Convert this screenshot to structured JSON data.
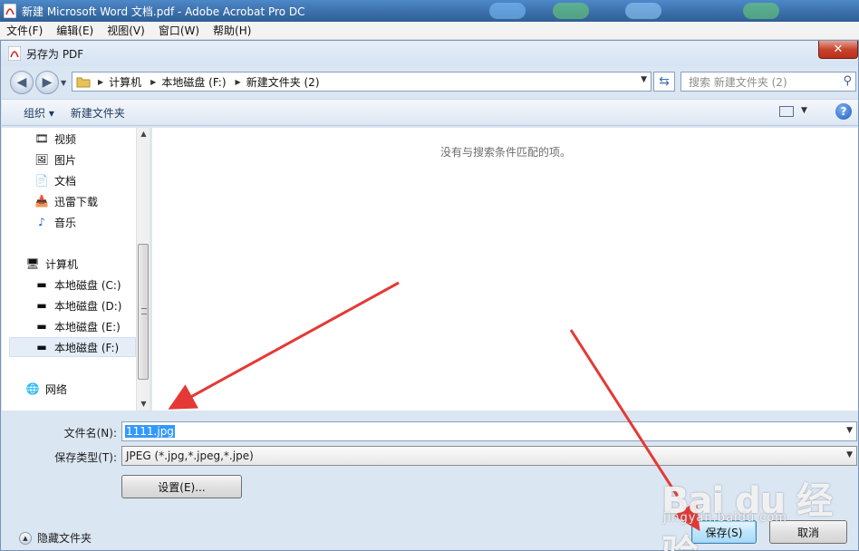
{
  "app": {
    "title": "新建 Microsoft Word 文档.pdf - Adobe Acrobat Pro DC",
    "menu": [
      "文件(F)",
      "编辑(E)",
      "视图(V)",
      "窗口(W)",
      "帮助(H)"
    ]
  },
  "dialog": {
    "title": "另存为 PDF",
    "close_label": "✕",
    "breadcrumb": [
      "计算机",
      "本地磁盘 (F:)",
      "新建文件夹 (2)"
    ],
    "search_placeholder": "搜索 新建文件夹 (2)",
    "toolbar": {
      "organize": "组织 ▾",
      "new_folder": "新建文件夹",
      "help": "?"
    },
    "nav_items": [
      {
        "label": "视频",
        "icon": "video-icon"
      },
      {
        "label": "图片",
        "icon": "picture-icon"
      },
      {
        "label": "文档",
        "icon": "document-icon"
      },
      {
        "label": "迅雷下载",
        "icon": "download-icon"
      },
      {
        "label": "音乐",
        "icon": "music-icon"
      },
      {
        "label": "计算机",
        "icon": "computer-icon"
      },
      {
        "label": "本地磁盘 (C:)",
        "icon": "drive-icon"
      },
      {
        "label": "本地磁盘 (D:)",
        "icon": "drive-icon"
      },
      {
        "label": "本地磁盘 (E:)",
        "icon": "drive-icon"
      },
      {
        "label": "本地磁盘 (F:)",
        "icon": "drive-icon",
        "selected": true
      },
      {
        "label": "网络",
        "icon": "network-icon"
      }
    ],
    "empty_message": "没有与搜索条件匹配的项。",
    "filename_label": "文件名(N):",
    "filename_value": "1111.jpg",
    "filetype_label": "保存类型(T):",
    "filetype_value": "JPEG (*.jpg,*.jpeg,*.jpe)",
    "settings_button": "设置(E)...",
    "hide_folders": "隐藏文件夹",
    "save_button": "保存(S)",
    "cancel_button": "取消"
  },
  "watermark": {
    "brand": "Bai du 经验",
    "url": "jingyan.baidu.com"
  },
  "colors": {
    "accent": "#3399ff",
    "arrow": "#e53935",
    "title_bar": "#3a6ea8"
  }
}
